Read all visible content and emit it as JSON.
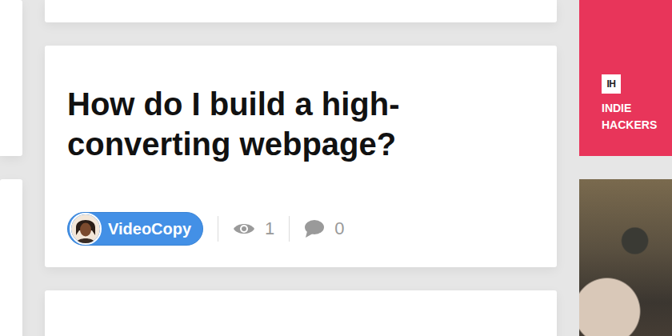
{
  "post": {
    "title": "How do I build a high-converting webpage?",
    "author": "VideoCopy",
    "views": "1",
    "comments": "0"
  },
  "sidebar": {
    "logo": "IH",
    "label": "INDIE HACKERS"
  }
}
